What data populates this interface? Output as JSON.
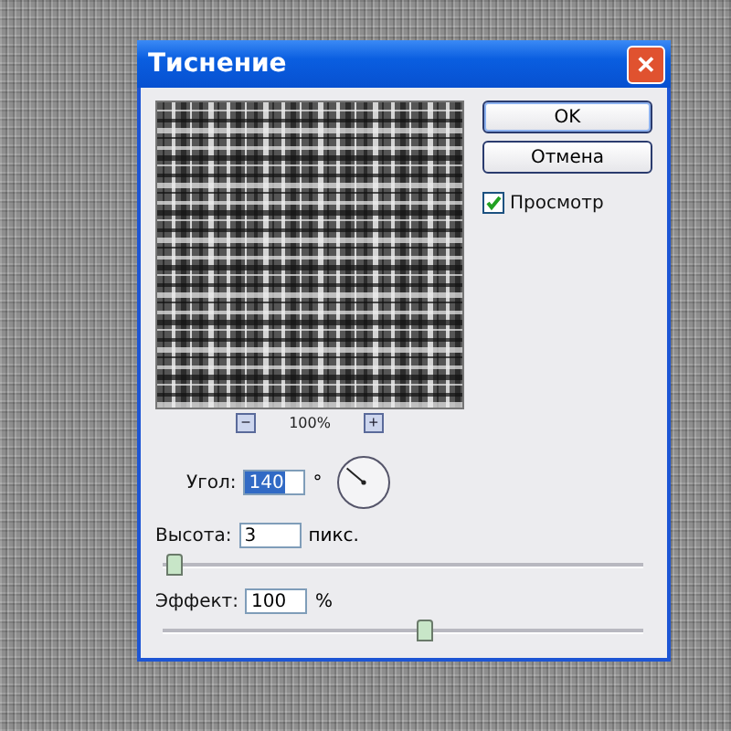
{
  "window": {
    "title": "Тиснение",
    "close_label": "✕"
  },
  "preview": {
    "zoom_out": "−",
    "zoom": "100%",
    "zoom_in": "+"
  },
  "buttons": [
    {
      "label": "OK"
    },
    {
      "label": "Отмена"
    }
  ],
  "preview_toggle": {
    "label": "Просмотр",
    "checked": true
  },
  "angle": {
    "label": "Угол:",
    "value": "140",
    "unit": "°"
  },
  "height": {
    "label": "Высота:",
    "value": "3",
    "unit": "пикс.",
    "level": 0.02
  },
  "effect": {
    "label": "Эффект:",
    "value": "100",
    "unit": "%",
    "level": 0.54
  }
}
